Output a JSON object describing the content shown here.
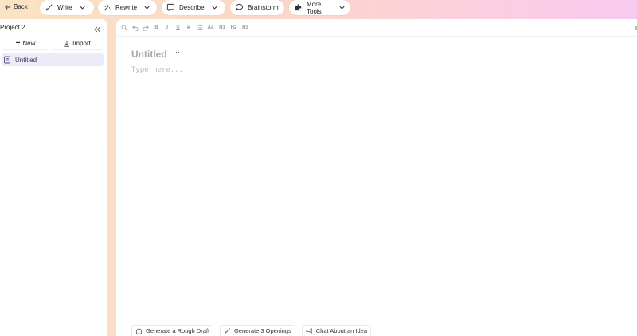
{
  "topbar": {
    "back_label": "Back",
    "tools": [
      {
        "label": "Write",
        "icon": "pen-icon",
        "dropdown": true
      },
      {
        "label": "Rewrite",
        "icon": "rewrite-icon",
        "dropdown": true
      },
      {
        "label": "Describe",
        "icon": "describe-icon",
        "dropdown": true
      },
      {
        "label": "Brainstorm",
        "icon": "brainstorm-icon",
        "dropdown": false
      },
      {
        "label": "More Tools",
        "icon": "puzzle-icon",
        "dropdown": true
      }
    ]
  },
  "sidebar": {
    "project_title": "Project 2",
    "new_label": "New",
    "import_label": "Import",
    "documents": [
      {
        "title": "Untitled",
        "selected": true
      }
    ]
  },
  "editor": {
    "toolbar_icons": [
      "search-icon",
      "undo-icon",
      "redo-icon",
      "bold-icon",
      "italic-icon",
      "underline-icon",
      "strikethrough-icon",
      "list-icon",
      "font-size-icon",
      "heading1-icon",
      "heading2-icon",
      "heading3-icon"
    ],
    "doc_title": "Untitled",
    "more_label": "···",
    "placeholder": "Type here..."
  },
  "actions": [
    {
      "label": "Generate a Rough Draft",
      "icon": "draft-icon"
    },
    {
      "label": "Generate 3 Openings",
      "icon": "pen-icon"
    },
    {
      "label": "Chat About an Idea",
      "icon": "chat-icon"
    }
  ],
  "colors": {
    "selected_bg": "#efeaf7",
    "placeholder": "#b8b8b8",
    "gradient_start": "#fbe3c3",
    "gradient_end": "#f7c7f5"
  }
}
